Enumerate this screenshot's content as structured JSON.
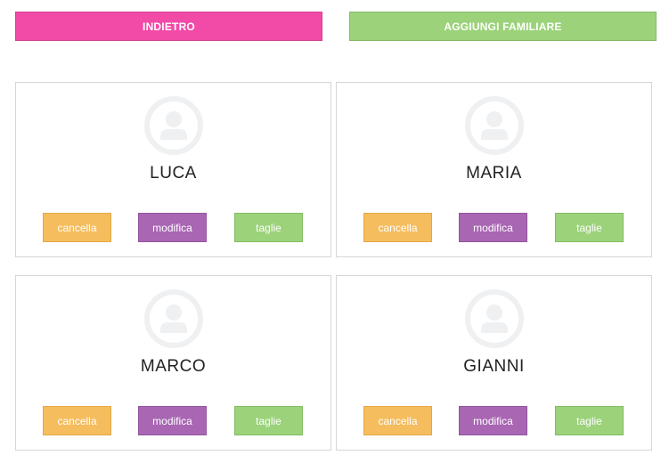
{
  "header": {
    "back_label": "INDIETRO",
    "add_label": "AGGIUNGI FAMILIARE"
  },
  "members": [
    {
      "name": "LUCA",
      "delete_label": "cancella",
      "edit_label": "modifica",
      "sizes_label": "taglie"
    },
    {
      "name": "MARIA",
      "delete_label": "cancella",
      "edit_label": "modifica",
      "sizes_label": "taglie"
    },
    {
      "name": "MARCO",
      "delete_label": "cancella",
      "edit_label": "modifica",
      "sizes_label": "taglie"
    },
    {
      "name": "GIANNI",
      "delete_label": "cancella",
      "edit_label": "modifica",
      "sizes_label": "taglie"
    }
  ],
  "icons": {
    "avatar": "user-placeholder-icon"
  },
  "colors": {
    "back": "#f24aa7",
    "add": "#9bd27a",
    "delete": "#f5bd5e",
    "edit": "#a866b3",
    "sizes": "#9bd27a"
  }
}
